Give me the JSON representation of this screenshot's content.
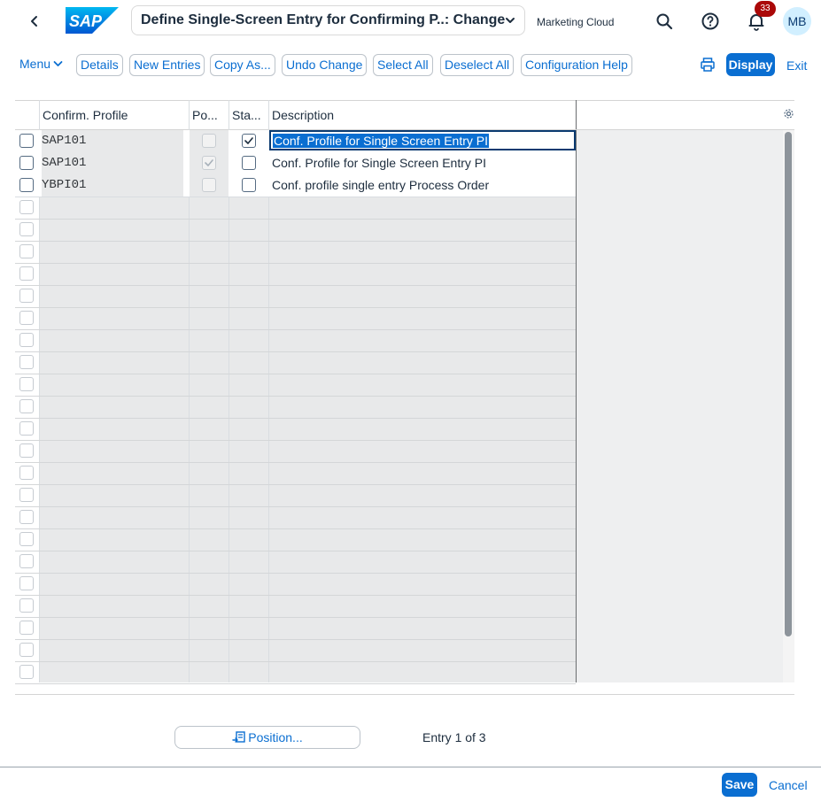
{
  "shell": {
    "logo_text": "SAP",
    "title": "Define Single-Screen Entry for Confirming P..: Change",
    "system": "Marketing Cloud",
    "notification_count": "33",
    "avatar_initials": "MB"
  },
  "toolbar": {
    "menu_label": "Menu",
    "buttons": [
      "Details",
      "New Entries",
      "Copy As...",
      "Undo Change",
      "Select All",
      "Deselect All",
      "Configuration Help"
    ],
    "display_label": "Display",
    "exit_label": "Exit"
  },
  "table": {
    "columns": [
      "Confirm. Profile",
      "Po...",
      "Sta...",
      "Description"
    ],
    "rows": [
      {
        "profile": "SAP101",
        "po": false,
        "po_disabled": true,
        "sta": true,
        "description": "Conf. Profile for Single Screen Entry PI",
        "editing": true
      },
      {
        "profile": "SAP101",
        "po": true,
        "po_disabled": true,
        "sta": false,
        "description": "Conf. Profile for Single Screen Entry PI",
        "editing": false
      },
      {
        "profile": "YBPI01",
        "po": false,
        "po_disabled": true,
        "sta": false,
        "description": "Conf. profile single entry Process Order",
        "editing": false
      }
    ],
    "empty_rows": 22
  },
  "footer": {
    "position_label": "Position...",
    "entry_text": "Entry 1 of 3",
    "save_label": "Save",
    "cancel_label": "Cancel"
  },
  "colors": {
    "accent": "#0a6ed1",
    "badge": "#aa0808",
    "text": "#1d2d3e"
  }
}
